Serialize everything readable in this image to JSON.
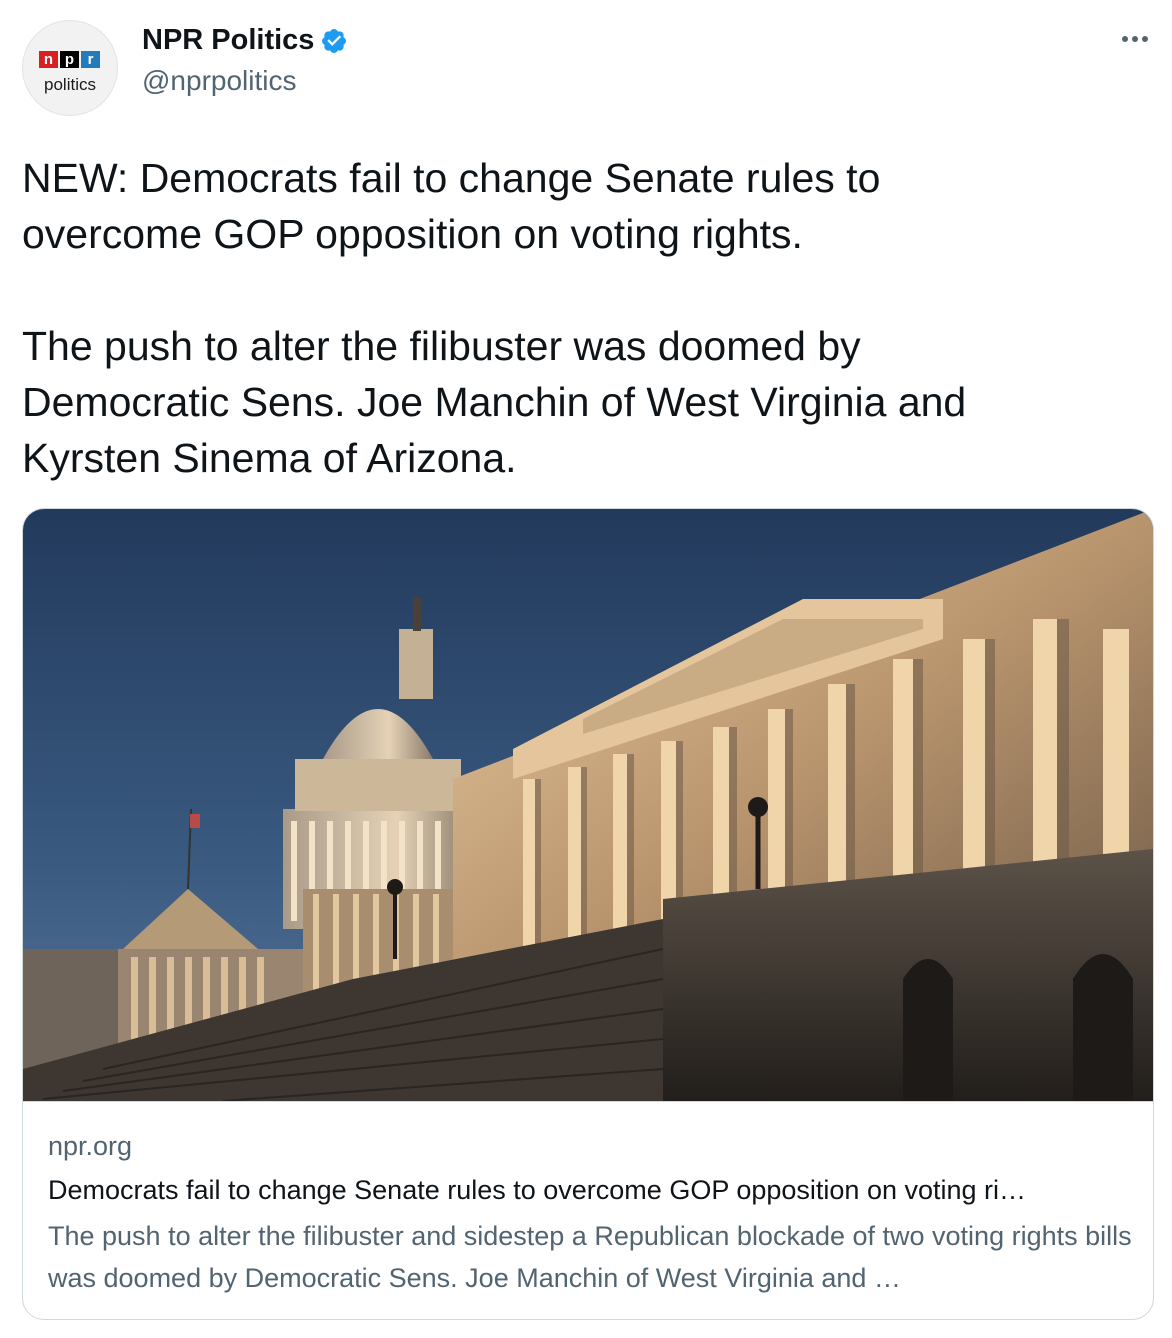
{
  "author": {
    "display_name": "NPR Politics",
    "handle": "@nprpolitics",
    "verified": true,
    "avatar": {
      "logo_letters": [
        "n",
        "p",
        "r"
      ],
      "logo_word": "politics"
    }
  },
  "tweet": {
    "text": "NEW: Democrats fail to change Senate rules to\novercome GOP opposition on voting rights.\n\nThe push to alter the filibuster was doomed by\nDemocratic Sens. Joe Manchin of West Virginia and\nKyrsten Sinema of Arizona."
  },
  "link_card": {
    "domain": "npr.org",
    "title": "Democrats fail to change Senate rules to overcome GOP opposition on voting ri…",
    "description": "The push to alter the filibuster and sidestep a Republican blockade of two voting rights bills was doomed by Democratic Sens. Joe Manchin of West Virginia and …"
  },
  "icons": {
    "verified": "verified-badge-icon",
    "more": "more-options-icon"
  },
  "colors": {
    "verified_blue": "#1d9bf0",
    "secondary_text": "#536471",
    "card_border": "#cfd9de"
  }
}
